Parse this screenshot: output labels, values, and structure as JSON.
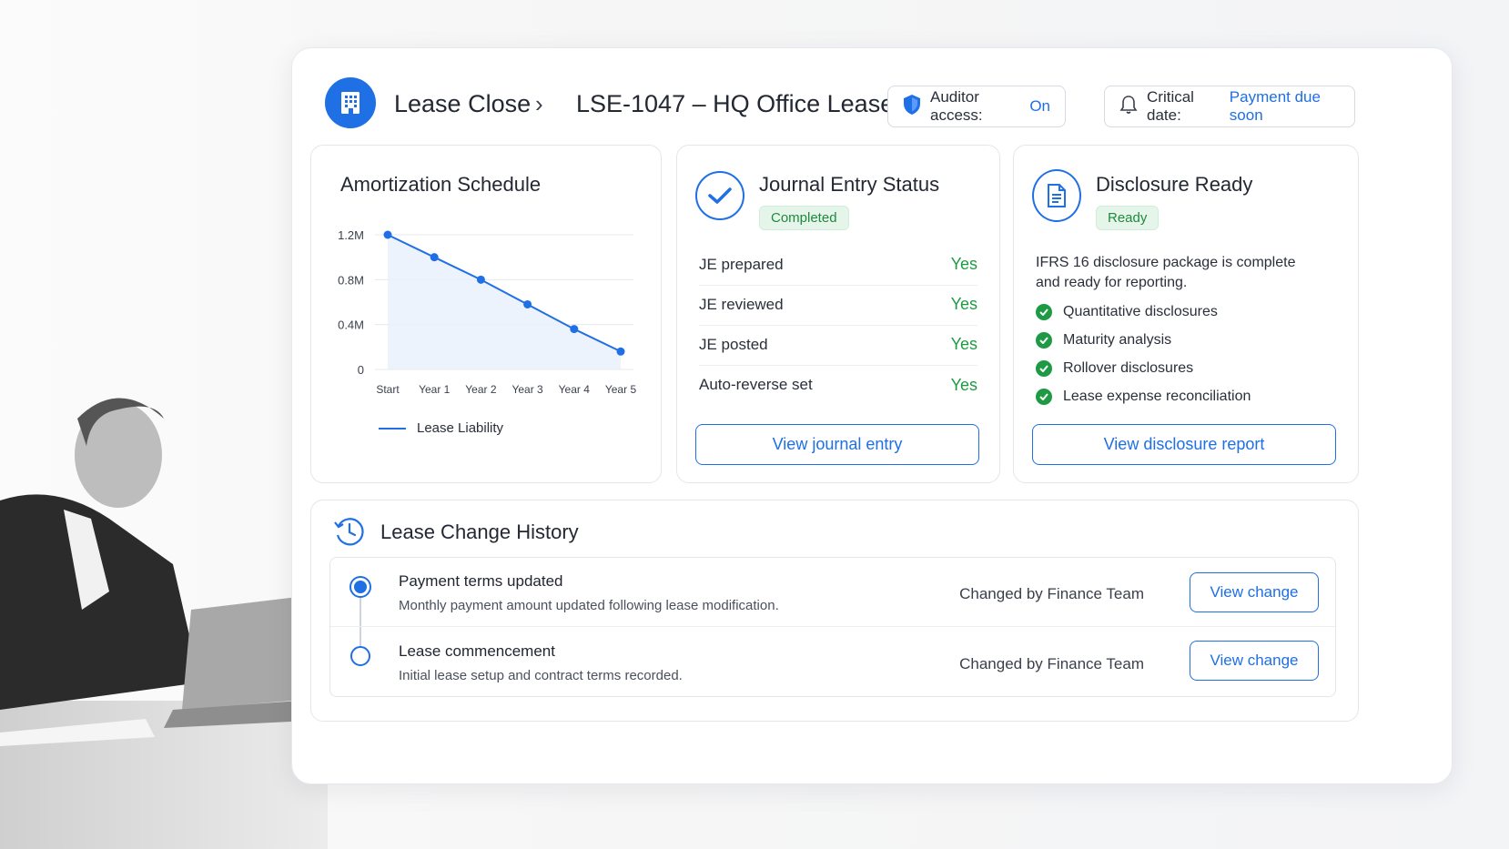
{
  "header": {
    "title": "Lease Close",
    "lease_name": "LSE-1047 – HQ Office Lease",
    "auditor_label": "Auditor access:",
    "auditor_value": "On",
    "critical_label": "Critical date:",
    "critical_value": "Payment due soon"
  },
  "amortization": {
    "title": "Amortization Schedule",
    "legend": "Lease Liability"
  },
  "chart_data": {
    "type": "line",
    "categories": [
      "Start",
      "Year 1",
      "Year 2",
      "Year 3",
      "Year 4",
      "Year 5"
    ],
    "series": [
      {
        "name": "Lease Liability",
        "values": [
          1.2,
          1.0,
          0.8,
          0.58,
          0.36,
          0.16
        ]
      }
    ],
    "yticks": [
      "0",
      "0.4M",
      "0.8M",
      "1.2M"
    ],
    "ylim": [
      0,
      1.2
    ],
    "grid": true,
    "legend_position": "bottom-left",
    "color": "#1f6fe5"
  },
  "journal": {
    "title": "Journal Entry Status",
    "badge": "Completed",
    "rows": [
      {
        "label": "JE prepared",
        "value": "Yes"
      },
      {
        "label": "JE reviewed",
        "value": "Yes"
      },
      {
        "label": "JE posted",
        "value": "Yes"
      },
      {
        "label": "Auto-reverse set",
        "value": "Yes"
      }
    ],
    "button": "View journal entry"
  },
  "disclosure": {
    "title": "Disclosure Ready",
    "badge": "Ready",
    "desc_line1": "IFRS 16 disclosure package is complete",
    "desc_line2": "and ready for reporting.",
    "items": [
      "Quantitative disclosures",
      "Maturity analysis",
      "Rollover disclosures",
      "Lease expense reconciliation"
    ],
    "button": "View disclosure report"
  },
  "history": {
    "title": "Lease Change History",
    "entries": [
      {
        "title": "Payment terms updated",
        "desc": "Monthly payment amount updated following lease modification.",
        "by": "Changed by Finance Team",
        "button": "View change"
      },
      {
        "title": "Lease commencement",
        "desc": "Initial lease setup and contract terms recorded.",
        "by": "Changed by Finance Team",
        "button": "View change"
      }
    ]
  },
  "colors": {
    "accent": "#1f6fe5",
    "success": "#1e9a45"
  }
}
